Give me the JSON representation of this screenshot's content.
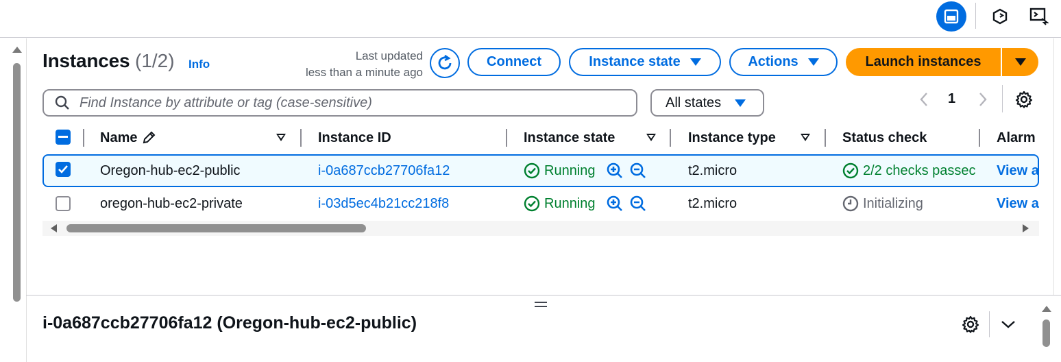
{
  "header": {
    "title": "Instances",
    "count": "(1/2)",
    "info_label": "Info",
    "last_updated_line1": "Last updated",
    "last_updated_line2": "less than a minute ago",
    "connect_label": "Connect",
    "instance_state_label": "Instance state",
    "actions_label": "Actions",
    "launch_label": "Launch instances"
  },
  "filter": {
    "search_placeholder": "Find Instance by attribute or tag (case-sensitive)",
    "state_filter": "All states",
    "page": "1"
  },
  "table": {
    "columns": [
      "Name",
      "Instance ID",
      "Instance state",
      "Instance type",
      "Status check",
      "Alarm"
    ],
    "rows": [
      {
        "selected": true,
        "name": "Oregon-hub-ec2-public",
        "instance_id": "i-0a687ccb27706fa12",
        "state": "Running",
        "type": "t2.micro",
        "status_check": "2/2 checks passec",
        "alarm": "View a"
      },
      {
        "selected": false,
        "name": "oregon-hub-ec2-private",
        "instance_id": "i-03d5ec4b21cc218f8",
        "state": "Running",
        "type": "t2.micro",
        "status_check": "Initializing",
        "alarm": "View a"
      }
    ]
  },
  "details": {
    "title": "i-0a687ccb27706fa12 (Oregon-hub-ec2-public)"
  },
  "colors": {
    "accent": "#006ce0",
    "primary_button": "#ff9900",
    "success": "#00802f",
    "muted": "#656871"
  }
}
